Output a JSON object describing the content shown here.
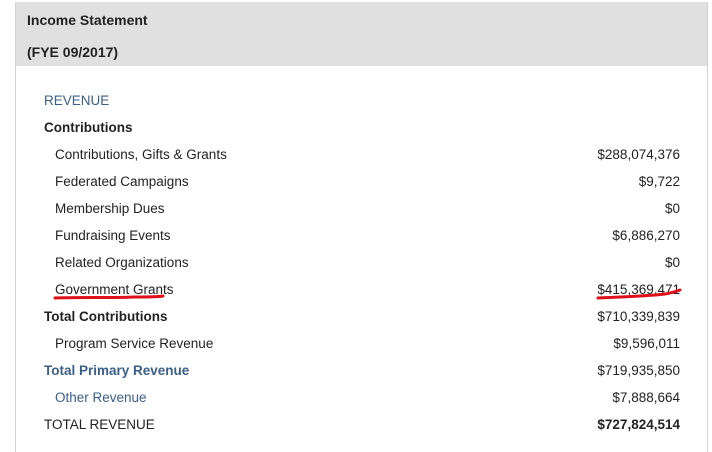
{
  "header": {
    "title": "Income Statement",
    "subtitle": "(FYE 09/2017)"
  },
  "section_heading": "REVENUE",
  "group_heading": "Contributions",
  "rows": [
    {
      "label": "Contributions, Gifts & Grants",
      "value": "$288,074,376"
    },
    {
      "label": "Federated Campaigns",
      "value": "$9,722"
    },
    {
      "label": "Membership Dues",
      "value": "$0"
    },
    {
      "label": "Fundraising Events",
      "value": "$6,886,270"
    },
    {
      "label": "Related Organizations",
      "value": "$0"
    },
    {
      "label": "Government Grants",
      "value": "$415,369,471"
    },
    {
      "label": "Total Contributions",
      "value": "$710,339,839"
    },
    {
      "label": "Program Service Revenue",
      "value": "$9,596,011"
    },
    {
      "label": "Total Primary Revenue",
      "value": "$719,935,850"
    },
    {
      "label": "Other Revenue",
      "value": "$7,888,664"
    },
    {
      "label": "TOTAL REVENUE",
      "value": "$727,824,514"
    }
  ],
  "annotation_color": "#e0101a"
}
